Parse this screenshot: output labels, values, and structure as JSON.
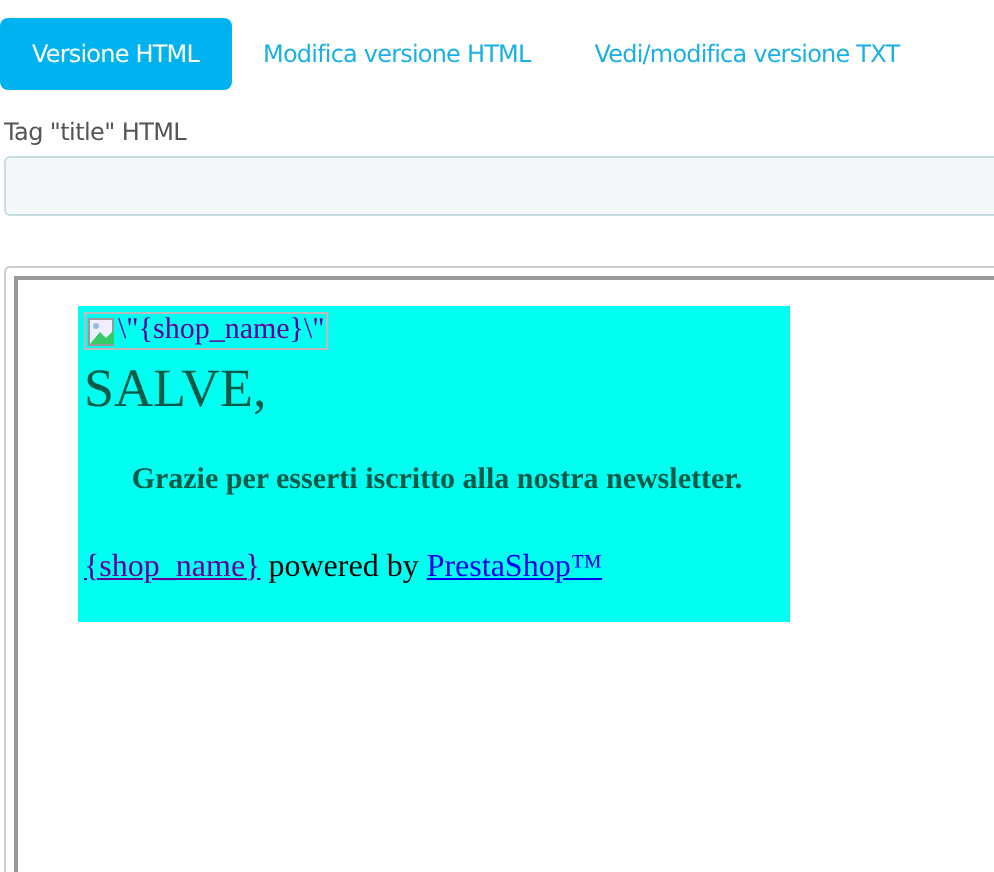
{
  "tabs": [
    {
      "label": "Versione HTML",
      "selected": true
    },
    {
      "label": "Modifica versione HTML",
      "selected": false
    },
    {
      "label": "Vedi/modifica versione TXT",
      "selected": false
    }
  ],
  "title_field": {
    "label": "Tag \"title\" HTML"
  },
  "preview": {
    "image_alt": "\\\"{shop_name}\\\"",
    "heading": "SALVE,",
    "message": "Grazie per esserti iscritto alla nostra newsletter.",
    "footer_shop_link": "{shop_name}",
    "footer_text": "powered by",
    "footer_brand_link": "PrestaShop™"
  }
}
